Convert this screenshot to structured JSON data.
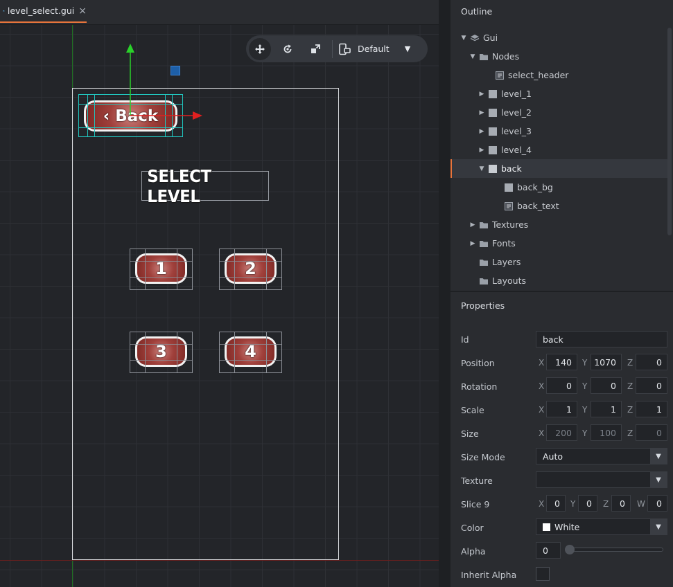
{
  "tab": {
    "title": "level_select.gui",
    "close": "×"
  },
  "toolbar": {
    "layout_label": "Default"
  },
  "scene": {
    "back_button_text": "‹ Back",
    "header_text": "SELECT LEVEL",
    "level_labels": [
      "1",
      "2",
      "3",
      "4"
    ]
  },
  "outline": {
    "title": "Outline",
    "items": [
      {
        "label": "Gui"
      },
      {
        "label": "Nodes"
      },
      {
        "label": "select_header"
      },
      {
        "label": "level_1"
      },
      {
        "label": "level_2"
      },
      {
        "label": "level_3"
      },
      {
        "label": "level_4"
      },
      {
        "label": "back"
      },
      {
        "label": "back_bg"
      },
      {
        "label": "back_text"
      },
      {
        "label": "Textures"
      },
      {
        "label": "Fonts"
      },
      {
        "label": "Layers"
      },
      {
        "label": "Layouts"
      }
    ]
  },
  "properties": {
    "title": "Properties",
    "id": {
      "label": "Id",
      "value": "back"
    },
    "position": {
      "label": "Position",
      "x": "140",
      "y": "1070",
      "z": "0"
    },
    "rotation": {
      "label": "Rotation",
      "x": "0",
      "y": "0",
      "z": "0"
    },
    "scale": {
      "label": "Scale",
      "x": "1",
      "y": "1",
      "z": "1"
    },
    "size": {
      "label": "Size",
      "x": "200",
      "y": "100",
      "z": "0"
    },
    "size_mode": {
      "label": "Size Mode",
      "value": "Auto"
    },
    "texture": {
      "label": "Texture",
      "value": ""
    },
    "slice9": {
      "label": "Slice 9",
      "x": "0",
      "y": "0",
      "z": "0",
      "w": "0"
    },
    "color": {
      "label": "Color",
      "value": "White"
    },
    "alpha": {
      "label": "Alpha",
      "value": "0"
    },
    "inherit_alpha": {
      "label": "Inherit Alpha"
    },
    "axes": {
      "x": "X",
      "y": "Y",
      "z": "Z",
      "w": "W"
    }
  },
  "colors": {
    "accent": "#e8743b",
    "button_fill": "#9e3a36",
    "gizmo_x": "#e02020",
    "gizmo_y": "#2ad12a"
  }
}
